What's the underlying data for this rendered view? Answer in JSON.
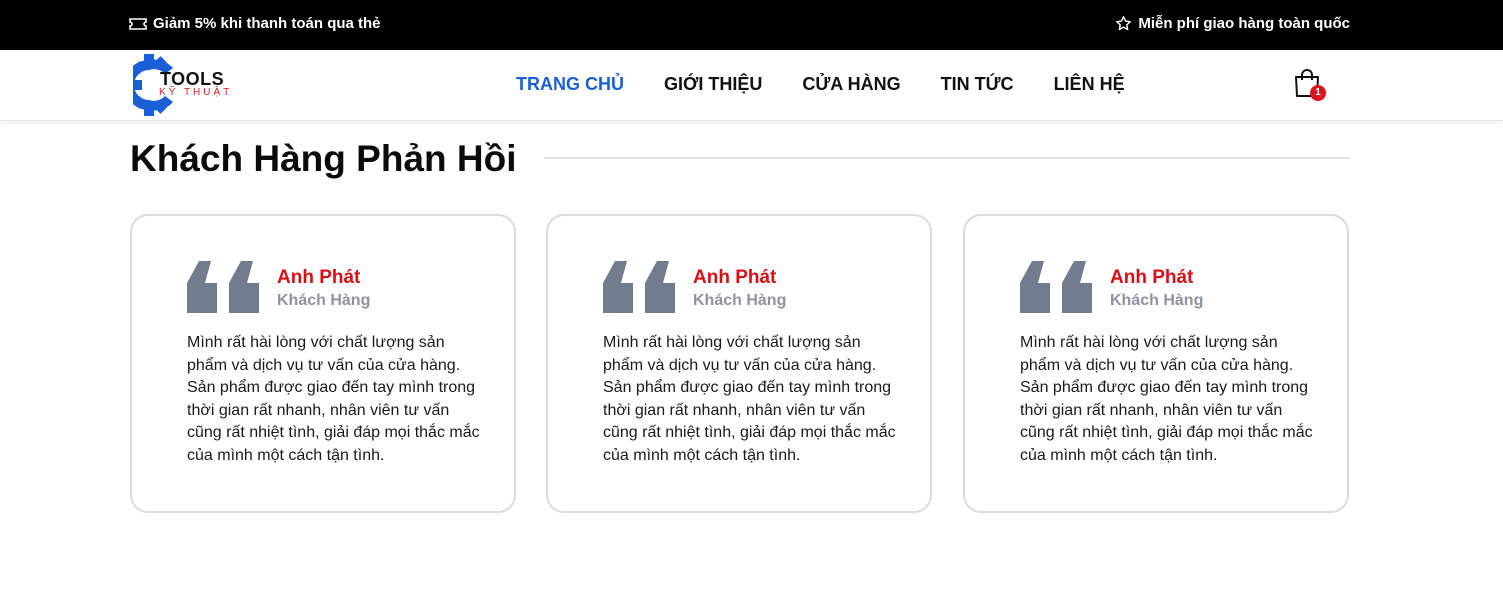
{
  "topbar": {
    "promo_left": "Giảm 5% khi thanh toán qua thẻ",
    "promo_left_icon": "ticket-icon",
    "promo_right": "Miễn phí giao hàng toàn quốc",
    "promo_right_icon": "star-icon"
  },
  "header": {
    "logo": {
      "word": "TOOLS",
      "sub": "KỸ THUẬT",
      "icon": "gear-icon",
      "icon_color": "#1a5fd8"
    },
    "nav": [
      {
        "label": "TRANG CHỦ",
        "active": true
      },
      {
        "label": "GIỚI THIỆU",
        "active": false
      },
      {
        "label": "CỬA HÀNG",
        "active": false
      },
      {
        "label": "TIN TỨC",
        "active": false
      },
      {
        "label": "LIÊN HỆ",
        "active": false
      }
    ],
    "cart": {
      "icon": "shopping-bag-icon",
      "count": "1"
    }
  },
  "section": {
    "title": "Khách Hàng Phản Hồi"
  },
  "testimonials": [
    {
      "name": "Anh Phát",
      "role": "Khách Hàng",
      "text": "Mình rất hài lòng với chất lượng sản phẩm và dịch vụ tư vấn của cửa hàng. Sản phẩm được giao đến tay mình trong thời gian rất nhanh, nhân viên tư vấn cũng rất nhiệt tình, giải đáp mọi thắc mắc của mình một cách tận tình."
    },
    {
      "name": "Anh Phát",
      "role": "Khách Hàng",
      "text": "Mình rất hài lòng với chất lượng sản phẩm và dịch vụ tư vấn của cửa hàng. Sản phẩm được giao đến tay mình trong thời gian rất nhanh, nhân viên tư vấn cũng rất nhiệt tình, giải đáp mọi thắc mắc của mình một cách tận tình."
    },
    {
      "name": "Anh Phát",
      "role": "Khách Hàng",
      "text": "Mình rất hài lòng với chất lượng sản phẩm và dịch vụ tư vấn của cửa hàng. Sản phẩm được giao đến tay mình trong thời gian rất nhanh, nhân viên tư vấn cũng rất nhiệt tình, giải đáp mọi thắc mắc của mình một cách tận tình."
    }
  ],
  "colors": {
    "accent": "#1a5fd8",
    "name_red": "#d80f16",
    "quote_gray": "#737b8e",
    "badge_red": "#e0121e"
  }
}
